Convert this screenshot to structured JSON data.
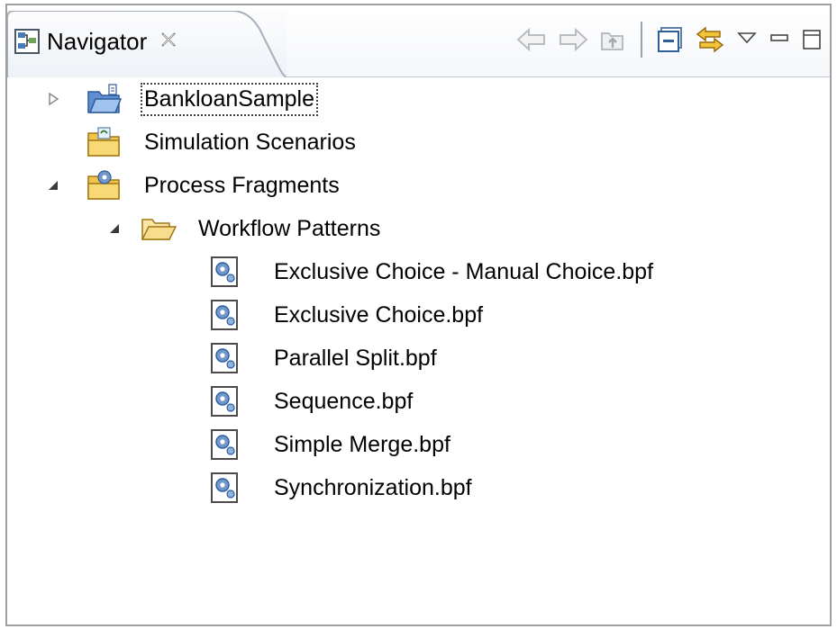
{
  "view": {
    "icon": "navigator-view-icon",
    "title": "Navigator",
    "close_icon": "close-tab-icon",
    "toolbar": [
      {
        "name": "back-button",
        "icon": "arrow-left-icon"
      },
      {
        "name": "forward-button",
        "icon": "arrow-right-icon"
      },
      {
        "name": "up-button",
        "icon": "go-up-icon"
      },
      {
        "name": "collapse-all-button",
        "icon": "collapse-all-icon"
      },
      {
        "name": "link-with-editor-button",
        "icon": "link-icon"
      },
      {
        "name": "view-menu-button",
        "icon": "view-menu-triangle-icon"
      },
      {
        "name": "minimize-button",
        "icon": "minimize-icon"
      },
      {
        "name": "maximize-button",
        "icon": "maximize-icon"
      }
    ]
  },
  "tree": [
    {
      "label": "BankloanSample",
      "state": "collapsed",
      "icon": "project-folder-icon",
      "focused": true
    },
    {
      "label": "Simulation Scenarios",
      "state": "none",
      "icon": "simulation-folder-icon"
    },
    {
      "label": "Process Fragments",
      "state": "expanded",
      "icon": "process-fragments-folder-icon"
    },
    {
      "label": "Workflow Patterns",
      "state": "expanded",
      "icon": "open-folder-icon"
    },
    {
      "label": "Exclusive Choice - Manual Choice.bpf",
      "state": "leaf",
      "icon": "bpf-file-icon"
    },
    {
      "label": "Exclusive Choice.bpf",
      "state": "leaf",
      "icon": "bpf-file-icon"
    },
    {
      "label": "Parallel Split.bpf",
      "state": "leaf",
      "icon": "bpf-file-icon"
    },
    {
      "label": "Sequence.bpf",
      "state": "leaf",
      "icon": "bpf-file-icon"
    },
    {
      "label": "Simple Merge.bpf",
      "state": "leaf",
      "icon": "bpf-file-icon"
    },
    {
      "label": "Synchronization.bpf",
      "state": "leaf",
      "icon": "bpf-file-icon"
    }
  ]
}
